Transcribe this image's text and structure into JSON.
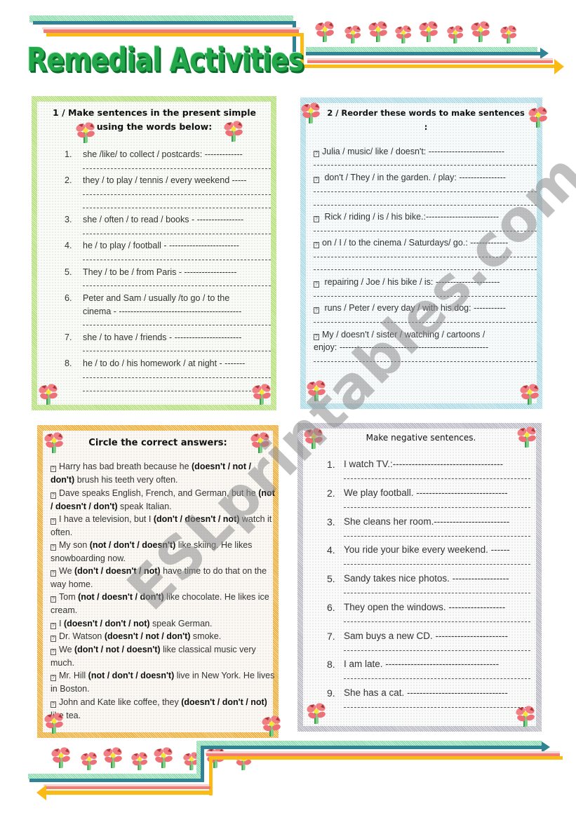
{
  "title": "Remedial Activities",
  "watermark": "ESLprintables.com",
  "colors": {
    "title_green": "#22a84b",
    "teal_stripe": "#2f8394",
    "salmon_stripe": "#f07e72",
    "gold_stripe": "#fbbb17",
    "flower_pink": "#f07e82"
  },
  "exercise1": {
    "heading_line1": "1 / Make sentences in the present simple",
    "heading_line2": "using the words below:",
    "items": [
      {
        "num": "1.",
        "text": "she  /like/ to collect / postcards: -------------"
      },
      {
        "num": "2.",
        "text": "they / to play / tennis / every weekend -----"
      },
      {
        "num": "3.",
        "text": "she / often / to read / books - ----------------"
      },
      {
        "num": "4.",
        "text": "he / to play / football - ------------------------"
      },
      {
        "num": "5.",
        "text": "They / to be / from Paris -   ------------------"
      },
      {
        "num": "6.",
        "text": "Peter and Sam  / usually /to go / to the",
        "text2": "cinema - ------------------------------------------"
      },
      {
        "num": "7.",
        "text": "she / to have / friends - -----------------------"
      },
      {
        "num": "8.",
        "text": "he / to do / his homework / at night - -------"
      }
    ]
  },
  "exercise2": {
    "heading": "2 / Reorder these words to make sentences :",
    "items": [
      {
        "text": "Julia / music/  like / doesn't: --------------------------"
      },
      {
        "text": " don't / They / in the garden. / play: ----------------"
      },
      {
        "text": " Rick / riding / is / his bike.:-------------------------"
      },
      {
        "text": "on / I / to the cinema / Saturdays/ go.: -------------"
      },
      {
        "text": " repairing / Joe / his bike / is: ----------------------"
      },
      {
        "text": " runs  / Peter / every day / with his dog: -----------"
      },
      {
        "text": "My / doesn't / sister / watching / cartoons /",
        "text2": "enjoy: ---------------------------------------------------"
      }
    ]
  },
  "exercise3": {
    "heading": "Circle the correct answers:",
    "items": [
      {
        "pre": "Harry has bad breath because he ",
        "choice": "(doesn't / not / don't)",
        "post": " brush his teeth very often."
      },
      {
        "pre": "Dave speaks English, French, and German, but he ",
        "choice": "(not / doesn't / don't)",
        "post": " speak Italian."
      },
      {
        "pre": "I have a television, but I ",
        "choice": "(don't / doesn't / not)",
        "post": " watch it often."
      },
      {
        "pre": "My son ",
        "choice": "(not / don't / doesn't)",
        "post": " like skiing. He likes snowboarding now."
      },
      {
        "pre": "We ",
        "choice": "(don't / doesn't / not)",
        "post": " have time to do that on the way home."
      },
      {
        "pre": "Tom ",
        "choice": "(not / doesn't / don't)",
        "post": " like chocolate.  He likes ice cream."
      },
      {
        "pre": "I ",
        "choice": "(doesn't / don't / not)",
        "post": " speak German."
      },
      {
        "pre": "Dr. Watson ",
        "choice": "(doesn't / not / don't)",
        "post": " smoke."
      },
      {
        "pre": "We ",
        "choice": "(don't / not / doesn't)",
        "post": " like classical music very much."
      },
      {
        "pre": "Mr. Hill ",
        "choice": "(not / don't / doesn't)",
        "post": " live in New York. He lives in Boston."
      },
      {
        "pre": "John and Kate like coffee, they ",
        "choice": "(doesn't / don't / not)",
        "post": " like tea."
      }
    ]
  },
  "exercise4": {
    "heading": "Make negative sentences.",
    "items": [
      {
        "num": "1.",
        "text": "I watch TV.:-----------------------------------"
      },
      {
        "num": "2.",
        "text": "We play football. -----------------------------"
      },
      {
        "num": "3.",
        "text": "She cleans her room.------------------------"
      },
      {
        "num": "4.",
        "text": "You ride your bike every weekend. ------"
      },
      {
        "num": "5.",
        "text": "Sandy takes nice photos. ------------------"
      },
      {
        "num": "6.",
        "text": "They open the windows. ------------------"
      },
      {
        "num": "7.",
        "text": "Sam buys a new CD. -----------------------"
      },
      {
        "num": "8.",
        "text": "I am late. ------------------------------------"
      },
      {
        "num": "9.",
        "text": "She has a cat. --------------------------------"
      }
    ]
  }
}
